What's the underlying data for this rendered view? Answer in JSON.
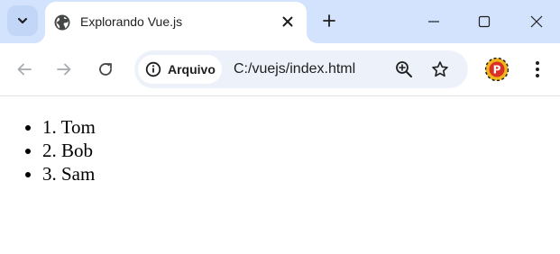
{
  "browser": {
    "tab": {
      "title": "Explorando Vue.js"
    },
    "address_bar": {
      "site_chip_label": "Arquivo",
      "url": "C:/vuejs/index.html"
    },
    "profile_initial": "P",
    "colors": {
      "tabstrip_bg": "#d3e3fd",
      "omnibox_bg": "#edf2fa",
      "icon_color": "#444746",
      "disabled_icon_color": "#a8abaf"
    }
  },
  "page": {
    "items": [
      {
        "text": "1. Tom"
      },
      {
        "text": "2. Bob"
      },
      {
        "text": "3. Sam"
      }
    ]
  }
}
